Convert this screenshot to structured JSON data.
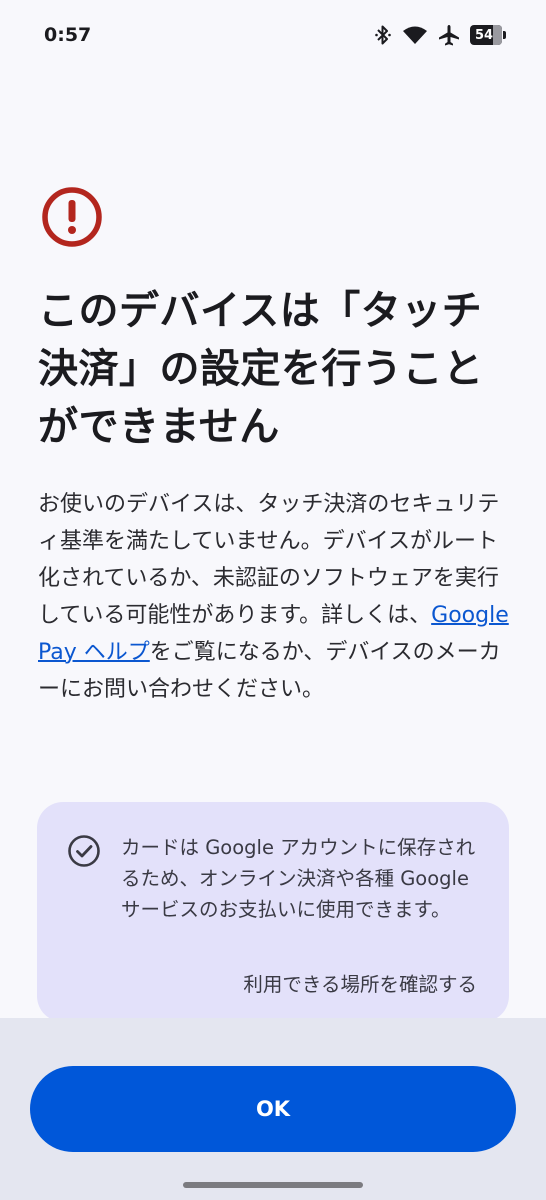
{
  "status_bar": {
    "time": "0:57",
    "battery_level": "54",
    "icons": [
      "bluetooth-icon",
      "wifi-icon",
      "airplane-icon",
      "battery-icon"
    ]
  },
  "alert": {
    "icon": "error-circle-icon",
    "icon_color": "#b3261e",
    "title_line1": "このデバイスは「タッチ",
    "title_line2": "決済」の設定を行うこと",
    "title_line3": "ができません",
    "body_part1": "お使いのデバイスは、タッチ決済のセキュリティ基準を満たしていません。デバイスがルート化されているか、未認証のソフトウェアを実行している可能性があります。詳しくは、",
    "help_link": "Google Pay ヘルプ",
    "body_part2": "をご覧になるか、デバイスのメーカーにお問い合わせください。"
  },
  "info_card": {
    "icon": "check-circle-icon",
    "text": "カードは Google アカウントに保存されるため、オンライン決済や各種 Google サービスのお支払いに使用できます。",
    "link": "利用できる場所を確認する"
  },
  "actions": {
    "ok_label": "OK",
    "accent_color": "#0057d9"
  }
}
